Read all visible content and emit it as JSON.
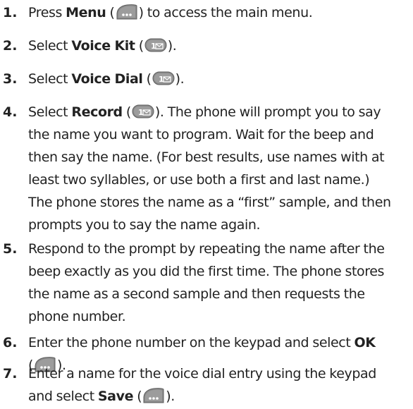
{
  "steps": [
    {
      "number": "1.",
      "pre": "Press ",
      "key_label": "Menu",
      "open": " (",
      "icon": "menu-softkey-icon",
      "close": ") to access the main menu."
    },
    {
      "number": "2.",
      "pre": "Select ",
      "key_label": "Voice Kit",
      "open": " (",
      "icon": "one-key-icon",
      "close": ")."
    },
    {
      "number": "3.",
      "pre": "Select ",
      "key_label": "Voice Dial",
      "open": " (",
      "icon": "one-key-icon",
      "close": ")."
    },
    {
      "number": "4.",
      "pre": "Select ",
      "key_label": "Record",
      "open": " (",
      "icon": "one-key-icon",
      "close": "). The phone will prompt you to say",
      "lines": [
        "the name you want to program. Wait for the beep and",
        "then say the name. (For best results, use names with at",
        "least two syllables, or use both a first and last name.)",
        "The phone stores the name as a “first” sample, and then",
        "prompts you to say the name again."
      ]
    },
    {
      "number": "5.",
      "lines": [
        "Respond to the prompt by repeating the name after the",
        "beep exactly as you did the first time. The phone stores",
        "the name as a second sample and then requests the",
        "phone number."
      ]
    },
    {
      "number": "6.",
      "pre": "Enter the phone number on the keypad and select ",
      "key_label": "OK",
      "open": "(",
      "icon": "menu-softkey-icon",
      "close": ")."
    },
    {
      "number": "7.",
      "pre": "Enter a name for the voice dial entry using the keypad",
      "pre2": "and select ",
      "key_label": "Save",
      "open": " (",
      "icon": "menu-softkey-icon",
      "close": ")."
    }
  ]
}
